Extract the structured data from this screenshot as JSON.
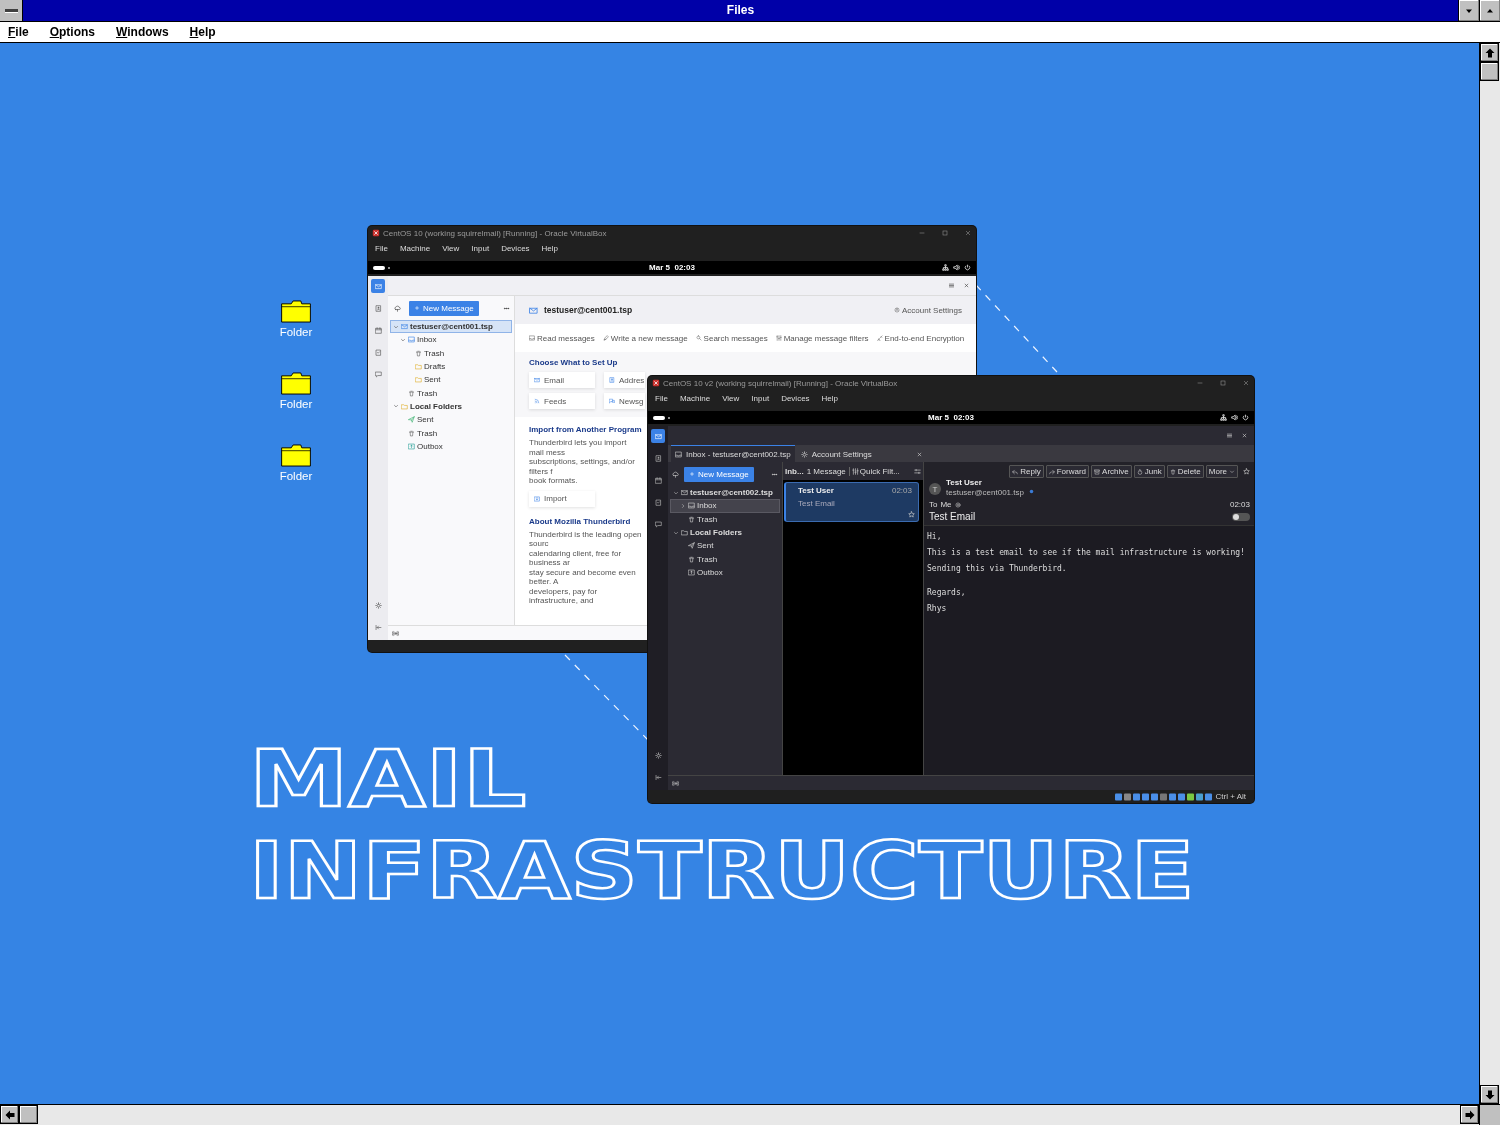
{
  "window": {
    "title": "Files"
  },
  "menu": [
    "File",
    "Options",
    "Windows",
    "Help"
  ],
  "desktop_icons": [
    {
      "label": "Folder"
    },
    {
      "label": "Folder"
    },
    {
      "label": "Folder"
    }
  ],
  "vm_back": {
    "title": "CentOS 10 (working squirrelmail) [Running] - Oracle VirtualBox",
    "menu": [
      "File",
      "Machine",
      "View",
      "Input",
      "Devices",
      "Help"
    ],
    "clock": "Mar 5  02:03",
    "rail": [
      {
        "kind": "mail",
        "selected": true
      },
      {
        "kind": "address",
        "selected": false
      },
      {
        "kind": "calendar",
        "selected": false
      },
      {
        "kind": "tasks",
        "selected": false
      },
      {
        "kind": "chat",
        "selected": false
      }
    ],
    "new_message": "New Message",
    "folders": [
      {
        "label": "testuser@cent001.tsp",
        "kind": "account",
        "selected": true,
        "expanded": true,
        "children": [
          {
            "label": "Inbox",
            "kind": "inbox",
            "selected": false,
            "expanded": true,
            "children": [
              {
                "label": "Trash",
                "kind": "trash",
                "selected": false
              },
              {
                "label": "Drafts",
                "kind": "folder",
                "selected": false
              },
              {
                "label": "Sent",
                "kind": "folder",
                "selected": false
              }
            ]
          },
          {
            "label": "Trash",
            "kind": "trash",
            "selected": false
          }
        ]
      },
      {
        "label": "Local Folders",
        "kind": "local",
        "selected": false,
        "expanded": true,
        "children": [
          {
            "label": "Sent",
            "kind": "sent",
            "selected": false
          },
          {
            "label": "Trash",
            "kind": "trash",
            "selected": false
          },
          {
            "label": "Outbox",
            "kind": "outbox",
            "selected": false
          }
        ]
      }
    ],
    "account_title": "testuser@cent001.tsp",
    "account_settings": "Account Settings",
    "actions": [
      {
        "label": "Read messages",
        "kind": "read"
      },
      {
        "label": "Write a new message",
        "kind": "write"
      },
      {
        "label": "Search messages",
        "kind": "search"
      },
      {
        "label": "Manage message filters",
        "kind": "filter"
      },
      {
        "label": "End-to-end Encryption",
        "kind": "key"
      }
    ],
    "setup": {
      "heading": "Choose What to Set Up",
      "tiles": [
        {
          "label": "Email",
          "kind": "email"
        },
        {
          "label": "Addres",
          "kind": "address"
        },
        {
          "label": "Feeds",
          "kind": "feed"
        },
        {
          "label": "Newsg",
          "kind": "news"
        }
      ]
    },
    "import": {
      "heading": "Import from Another Program",
      "lines": [
        "Thunderbird lets you import mail mess",
        "subscriptions, settings, and/or filters f",
        "book formats."
      ],
      "button": "Import"
    },
    "about": {
      "heading": "About Mozilla Thunderbird",
      "lines": [
        "Thunderbird is the leading open sourc",
        "calendaring client, free for business ar",
        "stay secure and become even better. A",
        "developers, pay for infrastructure, and"
      ]
    }
  },
  "vm_front": {
    "title": "CentOS 10 v2 (working squirrelmail) [Running] - Oracle VirtualBox",
    "menu": [
      "File",
      "Machine",
      "View",
      "Input",
      "Devices",
      "Help"
    ],
    "clock": "Mar 5  02:03",
    "rail": [
      {
        "kind": "mail",
        "selected": true
      },
      {
        "kind": "address",
        "selected": false
      },
      {
        "kind": "calendar",
        "selected": false
      },
      {
        "kind": "tasks",
        "selected": false
      },
      {
        "kind": "chat",
        "selected": false
      }
    ],
    "tabs": [
      {
        "label": "Inbox - testuser@cent002.tsp",
        "kind": "inbox",
        "selected": true,
        "closable": false
      },
      {
        "label": "Account Settings",
        "kind": "settings",
        "selected": false,
        "closable": true
      }
    ],
    "new_message": "New Message",
    "folders": [
      {
        "label": "testuser@cent002.tsp",
        "kind": "account",
        "selected": false,
        "expanded": true,
        "children": [
          {
            "label": "Inbox",
            "kind": "inbox",
            "selected": true,
            "expanded": false
          },
          {
            "label": "Trash",
            "kind": "trash",
            "selected": false
          }
        ]
      },
      {
        "label": "Local Folders",
        "kind": "local",
        "selected": false,
        "expanded": true,
        "children": [
          {
            "label": "Sent",
            "kind": "sent",
            "selected": false
          },
          {
            "label": "Trash",
            "kind": "trash",
            "selected": false
          },
          {
            "label": "Outbox",
            "kind": "outbox",
            "selected": false
          }
        ]
      }
    ],
    "list_header": {
      "folder": "Inb...",
      "count": "1 Message",
      "quick_filter": "Quick Filt..."
    },
    "messages": [
      {
        "sender": "Test User",
        "time": "02:03",
        "subject": "Test Email",
        "selected": true
      }
    ],
    "reader": {
      "buttons": [
        {
          "label": "Reply",
          "kind": "reply"
        },
        {
          "label": "Forward",
          "kind": "forward"
        },
        {
          "label": "Archive",
          "kind": "archive"
        },
        {
          "label": "Junk",
          "kind": "junk"
        },
        {
          "label": "Delete",
          "kind": "delete"
        },
        {
          "label": "More",
          "kind": "more"
        }
      ],
      "toggle": {
        "on": false
      },
      "avatar": "T",
      "sender": "Test User",
      "address": "testuser@cent001.tsp",
      "to_label": "To",
      "to": "Me",
      "time": "02:03",
      "subject": "Test Email",
      "body": [
        "Hi,",
        "This is a test email to see if the mail infrastructure is working!",
        "Sending this via Thunderbird.",
        "Regards,",
        "Rhys"
      ]
    },
    "vbox_status": "Ctrl + Alt"
  },
  "headline": [
    "MAIL",
    "INFRASTRUCTURE"
  ]
}
